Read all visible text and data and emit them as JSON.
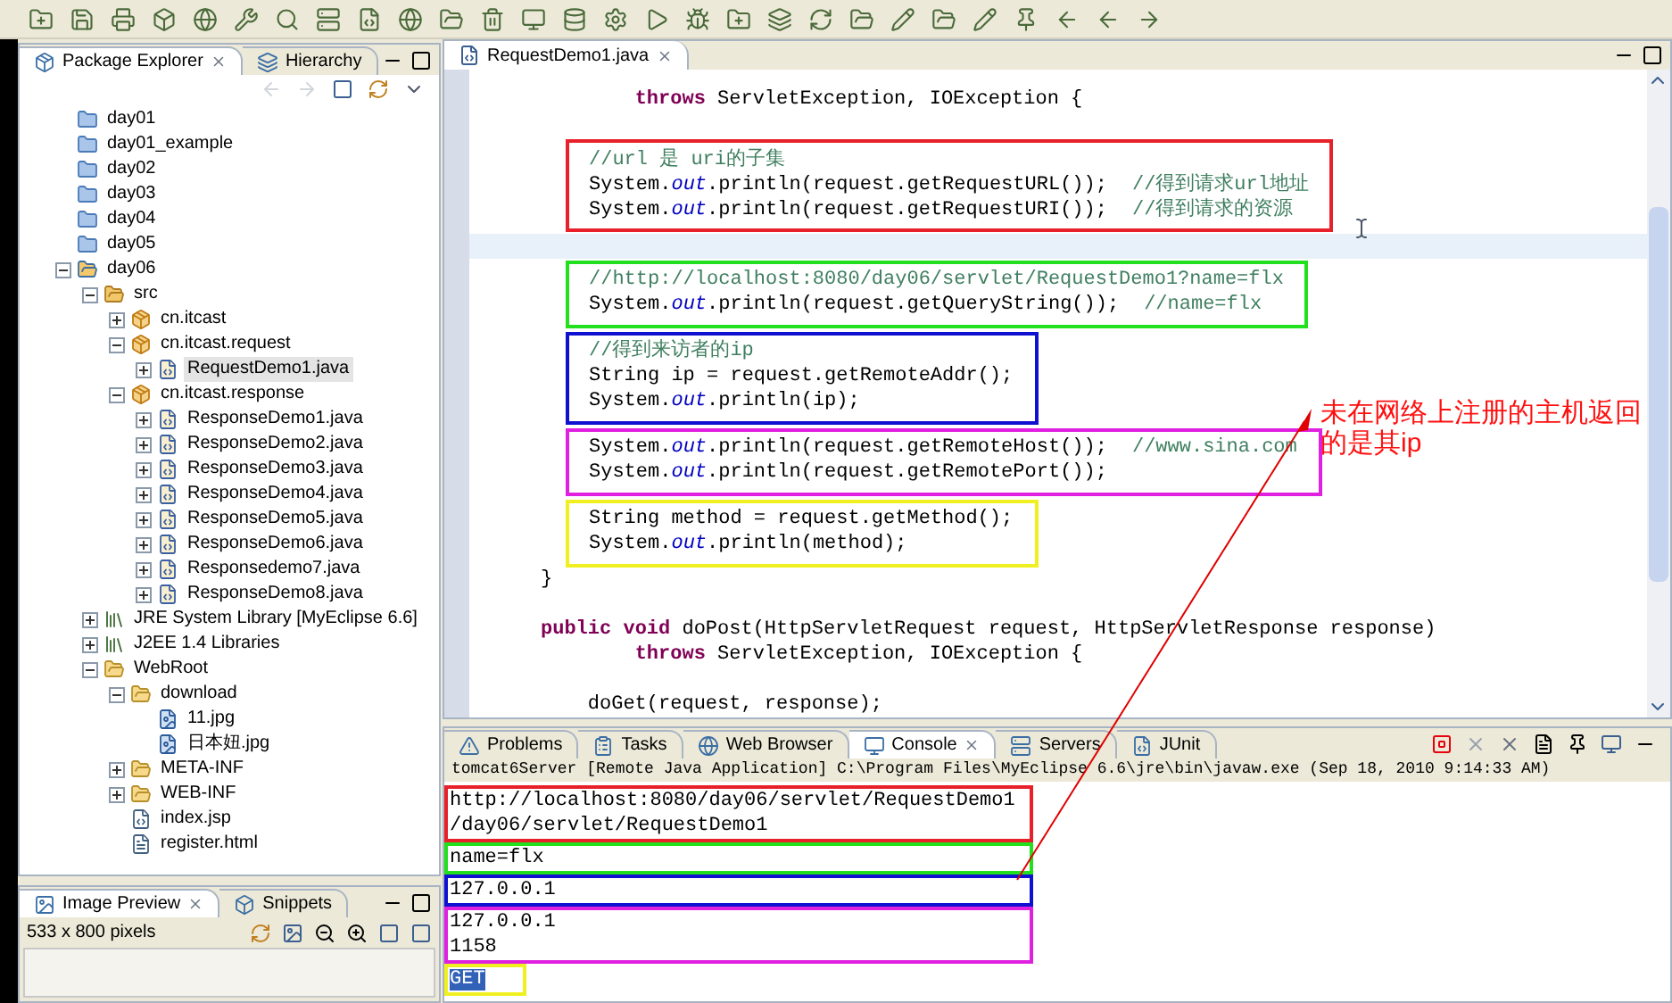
{
  "explorer": {
    "tabs": [
      {
        "label": "Package Explorer",
        "selected": true
      },
      {
        "label": "Hierarchy",
        "selected": false
      }
    ],
    "tree": [
      {
        "label": "day01",
        "kind": "project",
        "selected": false
      },
      {
        "label": "day01_example",
        "kind": "project",
        "selected": false
      },
      {
        "label": "day02",
        "kind": "project",
        "selected": false
      },
      {
        "label": "day03",
        "kind": "project",
        "selected": false
      },
      {
        "label": "day04",
        "kind": "project",
        "selected": false
      },
      {
        "label": "day05",
        "kind": "project",
        "selected": false
      },
      {
        "label": "day06",
        "kind": "web-project",
        "selected": false,
        "expanded": true,
        "children": [
          {
            "label": "src",
            "kind": "source-folder",
            "selected": false,
            "expanded": true,
            "children": [
              {
                "label": "cn.itcast",
                "kind": "package",
                "selected": false,
                "expanded": false
              },
              {
                "label": "cn.itcast.request",
                "kind": "package",
                "selected": false,
                "expanded": true,
                "children": [
                  {
                    "label": "RequestDemo1.java",
                    "kind": "java",
                    "selected": true,
                    "expanded": false
                  }
                ]
              },
              {
                "label": "cn.itcast.response",
                "kind": "package",
                "selected": false,
                "expanded": true,
                "children": [
                  {
                    "label": "ResponseDemo1.java",
                    "kind": "java",
                    "selected": false,
                    "expanded": false
                  },
                  {
                    "label": "ResponseDemo2.java",
                    "kind": "java",
                    "selected": false,
                    "expanded": false
                  },
                  {
                    "label": "ResponseDemo3.java",
                    "kind": "java",
                    "selected": false,
                    "expanded": false
                  },
                  {
                    "label": "ResponseDemo4.java",
                    "kind": "java",
                    "selected": false,
                    "expanded": false
                  },
                  {
                    "label": "ResponseDemo5.java",
                    "kind": "java",
                    "selected": false,
                    "expanded": false
                  },
                  {
                    "label": "ResponseDemo6.java",
                    "kind": "java",
                    "selected": false,
                    "expanded": false
                  },
                  {
                    "label": "Responsedemo7.java",
                    "kind": "java",
                    "selected": false,
                    "expanded": false
                  },
                  {
                    "label": "ResponseDemo8.java",
                    "kind": "java",
                    "selected": false,
                    "expanded": false
                  }
                ]
              }
            ]
          },
          {
            "label": "JRE System Library [MyEclipse 6.6]",
            "kind": "library",
            "selected": false,
            "expanded": false
          },
          {
            "label": "J2EE 1.4 Libraries",
            "kind": "library",
            "selected": false,
            "expanded": false
          },
          {
            "label": "WebRoot",
            "kind": "folder",
            "selected": false,
            "expanded": true,
            "children": [
              {
                "label": "download",
                "kind": "folder",
                "selected": false,
                "expanded": true,
                "children": [
                  {
                    "label": "11.jpg",
                    "kind": "image",
                    "selected": false
                  },
                  {
                    "label": "日本妞.jpg",
                    "kind": "image",
                    "selected": false
                  }
                ]
              },
              {
                "label": "META-INF",
                "kind": "folder",
                "selected": false,
                "expanded": false
              },
              {
                "label": "WEB-INF",
                "kind": "folder",
                "selected": false,
                "expanded": false
              },
              {
                "label": "index.jsp",
                "kind": "jsp",
                "selected": false
              },
              {
                "label": "register.html",
                "kind": "html",
                "selected": false
              }
            ]
          }
        ]
      }
    ]
  },
  "image_preview": {
    "tabs": [
      {
        "label": "Image Preview",
        "selected": true
      },
      {
        "label": "Snippets",
        "selected": false
      }
    ],
    "info": "533 x 800 pixels"
  },
  "editor": {
    "tab": "RequestDemo1.java",
    "blocks": [
      {
        "kind": "line",
        "code": "        **throws** ServletException, IOException {"
      },
      {
        "kind": "gap",
        "current": false
      },
      {
        "kind": "box",
        "color": "#e8202a",
        "lines": [
          {
            "comment": "//url 是 uri的子集"
          },
          {
            "code": "System.*out*.println(request.getRequestURL());",
            "comment": "//得到请求url地址"
          },
          {
            "code": "System.*out*.println(request.getRequestURI());",
            "comment": "//得到请求的资源"
          }
        ]
      },
      {
        "kind": "gap",
        "current": true
      },
      {
        "kind": "box",
        "color": "#22e01e",
        "lines": [
          {
            "comment": "//http://localhost:8080/day06/servlet/RequestDemo1?name=flx"
          },
          {
            "code": "System.*out*.println(request.getQueryString());",
            "comment": "//name=flx"
          }
        ]
      },
      {
        "kind": "box",
        "color": "#1010d0",
        "lines": [
          {
            "comment": "//得到来访者的ip"
          },
          {
            "code": "String ip = request.getRemoteAddr();"
          },
          {
            "code": "System.*out*.println(ip);"
          }
        ]
      },
      {
        "kind": "box",
        "color": "#e020e0",
        "lines": [
          {
            "code": "System.*out*.println(request.getRemoteHost());",
            "comment": "//www.sina.com"
          },
          {
            "code": "System.*out*.println(request.getRemotePort());"
          }
        ]
      },
      {
        "kind": "box",
        "color": "#f0f020",
        "lines": [
          {
            "code": "String method = request.getMethod();"
          },
          {
            "code": "System.*out*.println(method);"
          }
        ]
      },
      {
        "kind": "line",
        "code": "}"
      },
      {
        "kind": "gap",
        "current": false
      },
      {
        "kind": "line",
        "code": "**public** **void** doPost(HttpServletRequest request, HttpServletResponse response)"
      },
      {
        "kind": "line",
        "code": "        **throws** ServletException, IOException {"
      },
      {
        "kind": "gap",
        "current": false
      },
      {
        "kind": "line",
        "code": "    doGet(request, response);"
      }
    ]
  },
  "annotation": "未在网络上注册的主机返回的是其ip",
  "console": {
    "tabs": [
      {
        "label": "Problems",
        "selected": false
      },
      {
        "label": "Tasks",
        "selected": false
      },
      {
        "label": "Web Browser",
        "selected": false
      },
      {
        "label": "Console",
        "selected": true
      },
      {
        "label": "Servers",
        "selected": false
      },
      {
        "label": "JUnit",
        "selected": false
      }
    ],
    "header": "tomcat6Server [Remote Java Application] C:\\Program Files\\MyEclipse 6.6\\jre\\bin\\javaw.exe (Sep 18, 2010 9:14:33 AM)",
    "blocks": [
      {
        "color": "#e8202a",
        "lines": [
          {
            "text": "http://localhost:8080/day06/servlet/RequestDemo1",
            "selected": false
          },
          {
            "text": "/day06/servlet/RequestDemo1",
            "selected": false
          }
        ]
      },
      {
        "color": "#22e01e",
        "lines": [
          {
            "text": "name=flx",
            "selected": false
          }
        ]
      },
      {
        "color": "#1010d0",
        "lines": [
          {
            "text": "127.0.0.1",
            "selected": false
          }
        ]
      },
      {
        "color": "#e020e0",
        "lines": [
          {
            "text": "127.0.0.1",
            "selected": false
          },
          {
            "text": "1158",
            "selected": false
          }
        ]
      },
      {
        "color": "#f0f020",
        "lines": [
          {
            "text": "GET",
            "selected": true
          }
        ]
      }
    ]
  }
}
